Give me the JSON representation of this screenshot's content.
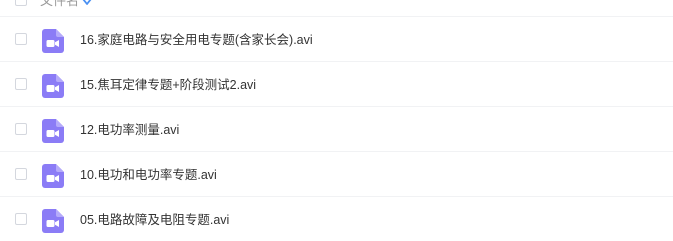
{
  "header": {
    "name_column_label": "文件名",
    "sort_icon": "sort-desc-icon"
  },
  "colors": {
    "video_icon": "#8b7cf6",
    "sort_icon": "#4a90f2",
    "divider": "#f1f2f4",
    "checkbox_border": "#d4d7de"
  },
  "files": [
    {
      "name": "16.家庭电路与安全用电专题(含家长会).avi",
      "icon": "video-file-icon"
    },
    {
      "name": "15.焦耳定律专题+阶段测试2.avi",
      "icon": "video-file-icon"
    },
    {
      "name": "12.电功率测量.avi",
      "icon": "video-file-icon"
    },
    {
      "name": "10.电功和电功率专题.avi",
      "icon": "video-file-icon"
    },
    {
      "name": "05.电路故障及电阻专题.avi",
      "icon": "video-file-icon"
    }
  ]
}
